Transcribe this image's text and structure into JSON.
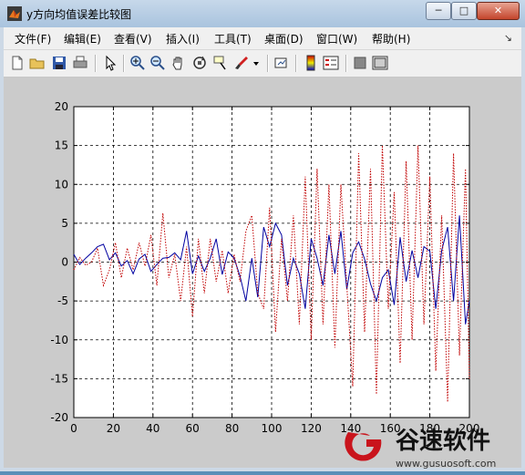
{
  "window": {
    "title": "y方向均值误差比较图"
  },
  "window_buttons": {
    "minimize": "─",
    "maximize": "□",
    "close": "✕"
  },
  "menu": [
    {
      "label": "文件(F)"
    },
    {
      "label": "编辑(E)"
    },
    {
      "label": "查看(V)"
    },
    {
      "label": "插入(I)"
    },
    {
      "label": "工具(T)"
    },
    {
      "label": "桌面(D)"
    },
    {
      "label": "窗口(W)"
    },
    {
      "label": "帮助(H)"
    }
  ],
  "menu_dock_glyph": "↘",
  "toolbar": {
    "icons": [
      "new-figure-icon",
      "open-file-icon",
      "save-icon",
      "print-icon",
      "select-arrow-icon",
      "zoom-in-icon",
      "zoom-out-icon",
      "pan-hand-icon",
      "rotate-3d-icon",
      "data-cursor-icon",
      "brush-icon",
      "dropdown-icon",
      "link-plot-icon",
      "colorbar-icon",
      "legend-icon",
      "hide-plot-tools-icon",
      "show-plot-tools-icon"
    ]
  },
  "watermark": {
    "brand": "谷速软件",
    "url": "www.gusuosoft.com"
  },
  "chart_data": {
    "type": "line",
    "xlim": [
      0,
      200
    ],
    "ylim": [
      -20,
      20
    ],
    "xticks": [
      "0",
      "20",
      "40",
      "60",
      "80",
      "100",
      "120",
      "140",
      "160",
      "180",
      "200"
    ],
    "yticks": [
      "20",
      "15",
      "10",
      "5",
      "0",
      "-5",
      "-10",
      "-15",
      "-20"
    ],
    "grid": true,
    "series": [
      {
        "style": "solid",
        "color": "#0000a0",
        "x": [
          0,
          3,
          6,
          9,
          12,
          15,
          18,
          21,
          24,
          27,
          30,
          33,
          36,
          39,
          42,
          45,
          48,
          51,
          54,
          57,
          60,
          63,
          66,
          69,
          72,
          75,
          78,
          81,
          84,
          87,
          90,
          93,
          96,
          99,
          102,
          105,
          108,
          111,
          114,
          117,
          120,
          123,
          126,
          129,
          132,
          135,
          138,
          141,
          144,
          147,
          150,
          153,
          156,
          159,
          162,
          165,
          168,
          171,
          174,
          177,
          180,
          183,
          186,
          189,
          192,
          195,
          198,
          200
        ],
        "y": [
          1,
          -0.3,
          0.5,
          1.2,
          2,
          2.3,
          0.3,
          1.2,
          -0.5,
          0.2,
          -1.5,
          0.4,
          1,
          -1.2,
          -0.3,
          0.5,
          0.6,
          1.2,
          0.3,
          4,
          -1.5,
          0.8,
          -1.2,
          0.5,
          3,
          -1.6,
          1.3,
          0.5,
          -1.8,
          -5,
          0.5,
          -4.5,
          4.5,
          2,
          5,
          3.5,
          -3,
          0.5,
          -1.5,
          -6,
          3,
          0.5,
          -3,
          3.5,
          -1.5,
          4,
          -3.5,
          1.2,
          2.6,
          0.4,
          -2.8,
          -5,
          -2,
          -1,
          -5.5,
          3.2,
          -2.5,
          1.5,
          -2,
          2,
          1.4,
          -6,
          1.5,
          4.5,
          -5,
          6,
          -8,
          -5
        ]
      },
      {
        "style": "dotted",
        "color": "#c00000",
        "x": [
          0,
          3,
          6,
          9,
          12,
          15,
          18,
          21,
          24,
          27,
          30,
          33,
          36,
          39,
          42,
          45,
          48,
          51,
          54,
          57,
          60,
          63,
          66,
          69,
          72,
          75,
          78,
          81,
          84,
          87,
          90,
          93,
          96,
          99,
          102,
          105,
          108,
          111,
          114,
          117,
          120,
          123,
          126,
          129,
          132,
          135,
          138,
          141,
          144,
          147,
          150,
          153,
          156,
          159,
          162,
          165,
          168,
          171,
          174,
          177,
          180,
          183,
          186,
          189,
          192,
          195,
          198,
          200
        ],
        "y": [
          -1,
          0.6,
          -0.4,
          0,
          1.8,
          -3,
          -1,
          2.5,
          -2,
          1.8,
          -1,
          2.5,
          -0.5,
          3.5,
          -3,
          6.3,
          -2,
          1,
          -5,
          2,
          -7,
          3,
          -4,
          3,
          -2.5,
          1.5,
          -4,
          1,
          -2.5,
          4,
          6,
          -4,
          -6,
          7,
          -9,
          3,
          -5,
          6,
          -8,
          11,
          -10,
          12,
          -8,
          10,
          -11,
          10,
          -3,
          -16,
          14,
          -9,
          12,
          -17,
          15,
          -6,
          9,
          -13,
          13,
          -10,
          15,
          -8,
          11,
          -14,
          6,
          -18,
          14,
          -12,
          12,
          -15
        ]
      }
    ]
  }
}
